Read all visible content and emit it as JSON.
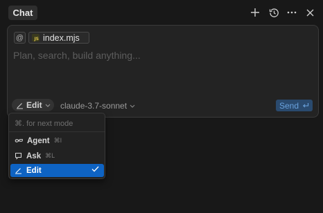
{
  "header": {
    "tab_label": "Chat"
  },
  "composer": {
    "at_symbol": "@",
    "file_chip": {
      "icon": "JS",
      "name": "index.mjs"
    },
    "placeholder": "Plan, search, build anything...",
    "mode_label": "Edit",
    "model_label": "claude-3.7-sonnet",
    "send_label": "Send"
  },
  "mode_menu": {
    "hint": "⌘. for next mode",
    "items": [
      {
        "label": "Agent",
        "shortcut": "⌘I",
        "icon": "infinity-icon"
      },
      {
        "label": "Ask",
        "shortcut": "⌘L",
        "icon": "chat-bubble-icon"
      },
      {
        "label": "Edit",
        "shortcut": "",
        "icon": "pencil-icon",
        "selected": true
      }
    ]
  },
  "colors": {
    "background": "#181818",
    "accent": "#0e63c3",
    "send_text": "#6aa2dd"
  }
}
